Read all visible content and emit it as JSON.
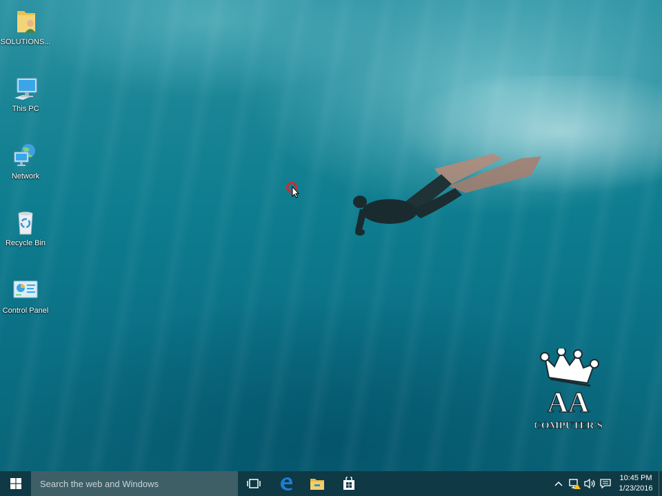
{
  "desktop": {
    "icons": [
      {
        "label": "SOLUTIONS...",
        "icon": "user-folder-icon"
      },
      {
        "label": "This PC",
        "icon": "computer-icon"
      },
      {
        "label": "Network",
        "icon": "network-icon"
      },
      {
        "label": "Recycle Bin",
        "icon": "recycle-bin-icon"
      },
      {
        "label": "Control Panel",
        "icon": "control-panel-icon"
      }
    ],
    "watermark": {
      "line1": "AA",
      "line2": "COMPUTER'S"
    }
  },
  "taskbar": {
    "search_placeholder": "Search the web and Windows",
    "apps": [
      "task-view-icon",
      "edge-icon",
      "file-explorer-icon",
      "store-icon"
    ],
    "clock": {
      "time": "10:45 PM",
      "date": "1/23/2016"
    }
  },
  "colors": {
    "taskbar": "#0f3944",
    "search": "#3f5f67",
    "accent": "#1a7fd4"
  }
}
